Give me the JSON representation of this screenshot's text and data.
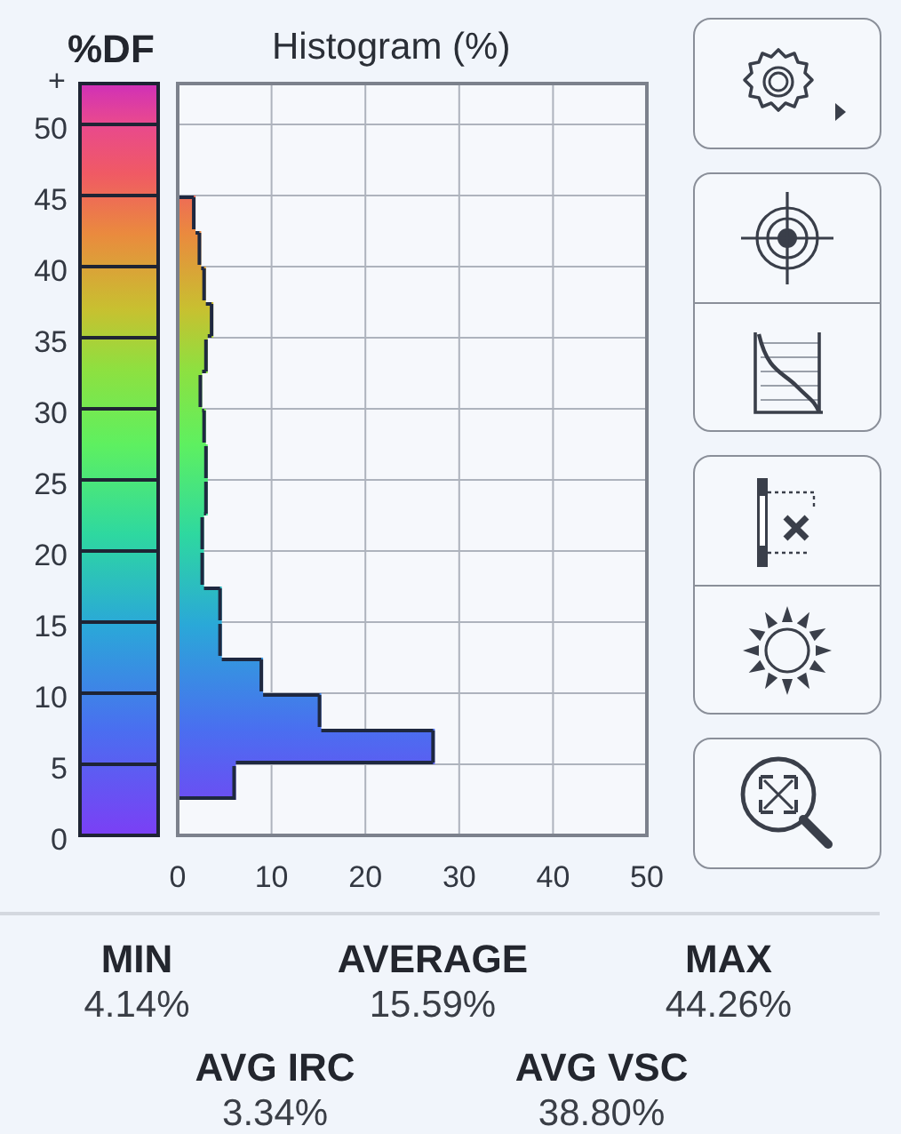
{
  "legend": {
    "title": "%DF",
    "overflow_label": "+"
  },
  "histogram": {
    "chart_data": {
      "type": "bar",
      "orientation": "horizontal",
      "title": "Histogram (%)",
      "x": [
        1.25,
        3.75,
        6.25,
        8.75,
        11.25,
        13.75,
        16.25,
        18.75,
        21.25,
        23.75,
        26.25,
        28.75,
        31.25,
        33.75,
        36.25,
        38.75,
        41.25,
        43.75
      ],
      "values": [
        0,
        6.2,
        27.4,
        15.3,
        9.1,
        4.7,
        4.7,
        2.8,
        2.8,
        3.2,
        3.2,
        3.0,
        2.6,
        3.2,
        3.8,
        3.0,
        2.5,
        1.9
      ],
      "xlim": [
        0,
        50
      ],
      "ylim": [
        0,
        50
      ],
      "xticks": [
        0,
        10,
        20,
        30,
        40,
        50
      ],
      "yticks": [
        0,
        5,
        10,
        15,
        20,
        25,
        30,
        35,
        40,
        45,
        50
      ],
      "grid": true
    }
  },
  "button_groups": [
    [
      {
        "kind": "settings"
      }
    ],
    [
      {
        "kind": "target"
      },
      {
        "kind": "curve"
      }
    ],
    [
      {
        "kind": "sensor"
      },
      {
        "kind": "sun"
      }
    ],
    [
      {
        "kind": "zoom"
      }
    ]
  ],
  "stats": [
    [
      {
        "label": "MIN",
        "value": "4.14%"
      },
      {
        "label": "AVERAGE",
        "value": "15.59%"
      },
      {
        "label": "MAX",
        "value": "44.26%"
      }
    ],
    [
      {
        "label": "AVG IRC",
        "value": "3.34%"
      },
      {
        "label": "AVG VSC",
        "value": "38.80%"
      }
    ]
  ]
}
